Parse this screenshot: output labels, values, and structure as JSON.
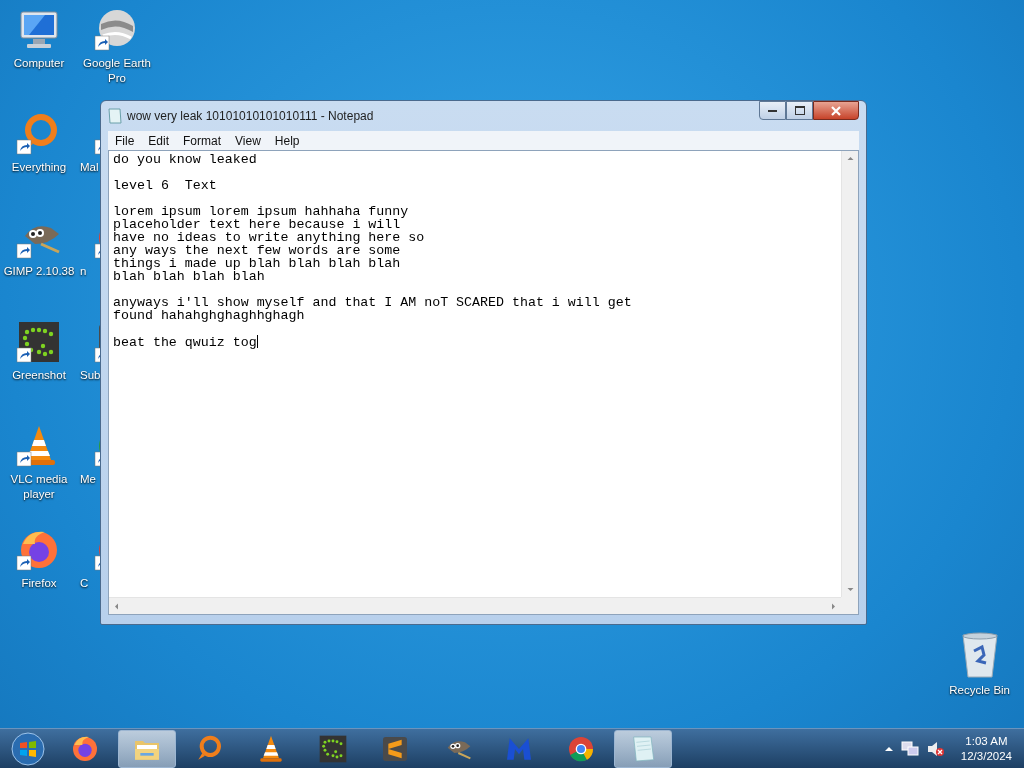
{
  "desktop_icons": [
    {
      "label": "Computer",
      "kind": "computer",
      "shortcut": false
    },
    {
      "label": "Everything",
      "kind": "everything",
      "shortcut": true
    },
    {
      "label": "GIMP 2.10.38",
      "kind": "gimp",
      "shortcut": true
    },
    {
      "label": "Greenshot",
      "kind": "greenshot",
      "shortcut": true
    },
    {
      "label": "VLC media player",
      "kind": "vlc",
      "shortcut": true
    },
    {
      "label": "Firefox",
      "kind": "firefox",
      "shortcut": true
    },
    {
      "label": "Google Earth Pro",
      "kind": "earth",
      "shortcut": true
    },
    {
      "label": "Mal",
      "kind": "malware",
      "shortcut": true
    },
    {
      "label": "n",
      "kind": "chrome",
      "shortcut": true
    },
    {
      "label": "Sub",
      "kind": "sublime",
      "shortcut": true
    },
    {
      "label": "Me",
      "kind": "media",
      "shortcut": true
    },
    {
      "label": "C",
      "kind": "chrome",
      "shortcut": true
    }
  ],
  "recycle_bin": {
    "label": "Recycle Bin"
  },
  "window": {
    "title": "wow very leak 10101010101010111 - Notepad",
    "menu": [
      "File",
      "Edit",
      "Format",
      "View",
      "Help"
    ],
    "paragraphs": [
      [
        "do you know leaked"
      ],
      [
        "level 6  Text"
      ],
      [
        "lorem ipsum lorem ipsum hahhaha funny",
        "placeholder text here because i will",
        "have no ideas to write anything here so",
        "any ways the next few words are some",
        "things i made up blah blah blah blah",
        "blah blah blah blah"
      ],
      [
        "anyways i'll show myself and that I AM noT SCARED that i will get",
        "found hahahghghaghhghagh"
      ],
      [
        "beat the qwuiz tog"
      ]
    ]
  },
  "taskbar": {
    "items": [
      {
        "kind": "firefox",
        "running": false
      },
      {
        "kind": "explorer",
        "running": true
      },
      {
        "kind": "everything",
        "running": false
      },
      {
        "kind": "vlc",
        "running": false
      },
      {
        "kind": "greenshot",
        "running": false
      },
      {
        "kind": "sublime",
        "running": false
      },
      {
        "kind": "gimp",
        "running": false
      },
      {
        "kind": "malware",
        "running": false
      },
      {
        "kind": "chrome",
        "running": false
      },
      {
        "kind": "notepad",
        "running": true
      }
    ],
    "time": "1:03 AM",
    "date": "12/3/2024"
  }
}
